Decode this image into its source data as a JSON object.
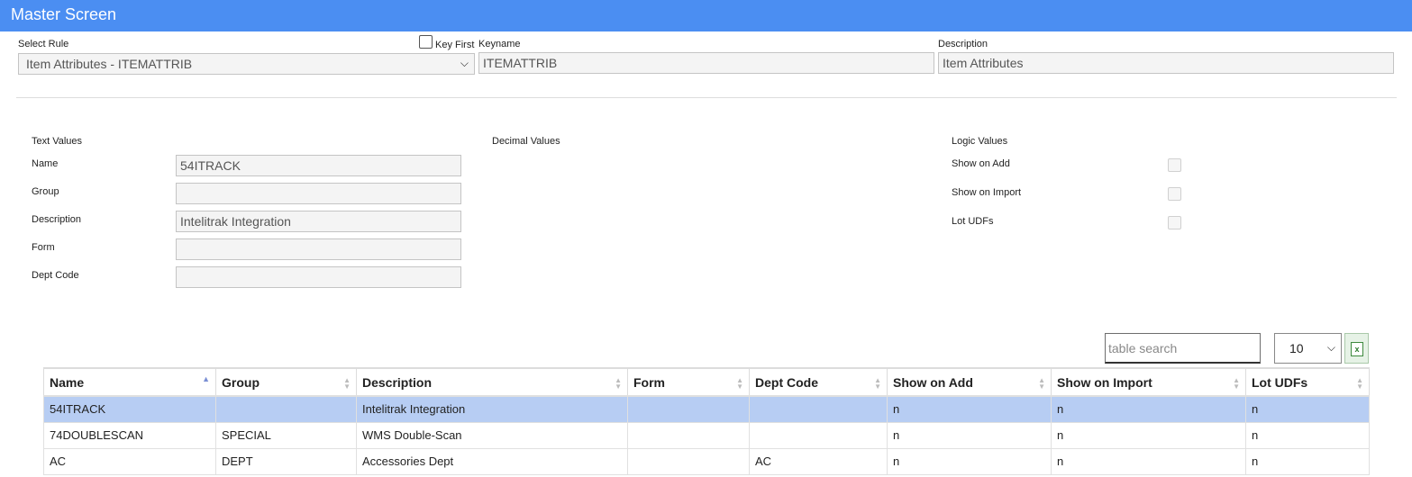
{
  "header": {
    "title": "Master Screen"
  },
  "top": {
    "select_rule_label": "Select Rule",
    "select_rule_value": "Item Attributes - ITEMATTRIB",
    "key_first_label": "Key First",
    "keyname_label": "Keyname",
    "keyname_value": "ITEMATTRIB",
    "description_label": "Description",
    "description_value": "Item Attributes"
  },
  "sections": {
    "text_values": "Text Values",
    "decimal_values": "Decimal Values",
    "logic_values": "Logic Values"
  },
  "text_fields": [
    {
      "label": "Name",
      "value": "54ITRACK"
    },
    {
      "label": "Group",
      "value": ""
    },
    {
      "label": "Description",
      "value": "Intelitrak Integration"
    },
    {
      "label": "Form",
      "value": ""
    },
    {
      "label": "Dept Code",
      "value": ""
    }
  ],
  "logic_fields": [
    {
      "label": "Show on Add",
      "checked": false
    },
    {
      "label": "Show on Import",
      "checked": false
    },
    {
      "label": "Lot UDFs",
      "checked": false
    }
  ],
  "table_controls": {
    "search_placeholder": "table search",
    "page_size": "10",
    "export_icon": "excel-icon"
  },
  "table": {
    "columns": [
      "Name",
      "Group",
      "Description",
      "Form",
      "Dept Code",
      "Show on Add",
      "Show on Import",
      "Lot UDFs"
    ],
    "sorted_column": "Name",
    "rows": [
      [
        "54ITRACK",
        "",
        "Intelitrak Integration",
        "",
        "",
        "n",
        "n",
        "n"
      ],
      [
        "74DOUBLESCAN",
        "SPECIAL",
        "WMS Double-Scan",
        "",
        "",
        "n",
        "n",
        "n"
      ],
      [
        "AC",
        "DEPT",
        "Accessories Dept",
        "",
        "AC",
        "n",
        "n",
        "n"
      ]
    ],
    "selected_row": 0
  },
  "colors": {
    "header_bg": "#4b8ef2",
    "selected_row": "#b7cdf3"
  }
}
